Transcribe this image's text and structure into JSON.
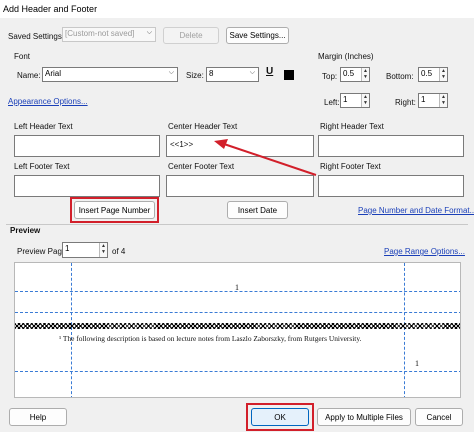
{
  "window": {
    "title": "Add Header and Footer"
  },
  "saved_settings": {
    "label": "Saved Settings:",
    "value": "[Custom-not saved]",
    "delete_label": "Delete",
    "save_label": "Save Settings..."
  },
  "font": {
    "group_label": "Font",
    "name_label": "Name:",
    "name_value": "Arial",
    "size_label": "Size:",
    "size_value": "8",
    "underline_glyph": "U",
    "color": "#000000"
  },
  "margin": {
    "group_label": "Margin (Inches)",
    "top_label": "Top:",
    "top_value": "0.5",
    "bottom_label": "Bottom:",
    "bottom_value": "0.5",
    "left_label": "Left:",
    "left_value": "1",
    "right_label": "Right:",
    "right_value": "1"
  },
  "appearance_link": "Appearance Options...",
  "header": {
    "left_label": "Left Header Text",
    "center_label": "Center Header Text",
    "center_value": "<<1>>",
    "right_label": "Right Header Text"
  },
  "footer": {
    "left_label": "Left Footer Text",
    "center_label": "Center Footer Text",
    "right_label": "Right Footer Text"
  },
  "insert_page_number_label": "Insert Page Number",
  "insert_date_label": "Insert Date",
  "page_number_format_link": "Page Number and Date Format...",
  "preview": {
    "group_label": "Preview",
    "page_label": "Preview Page",
    "page_value": "1",
    "of_label": "of 4",
    "range_link": "Page Range Options...",
    "header_number": "1",
    "body_text": "¹ The following description is based on lecture notes from Laszlo Zaborszky, from Rutgers University.",
    "footer_number": "1"
  },
  "buttons": {
    "help": "Help",
    "ok": "OK",
    "apply_multiple": "Apply to Multiple Files",
    "cancel": "Cancel"
  },
  "accent_red": "#d21f2a",
  "guide_blue": "#3a7bd5"
}
